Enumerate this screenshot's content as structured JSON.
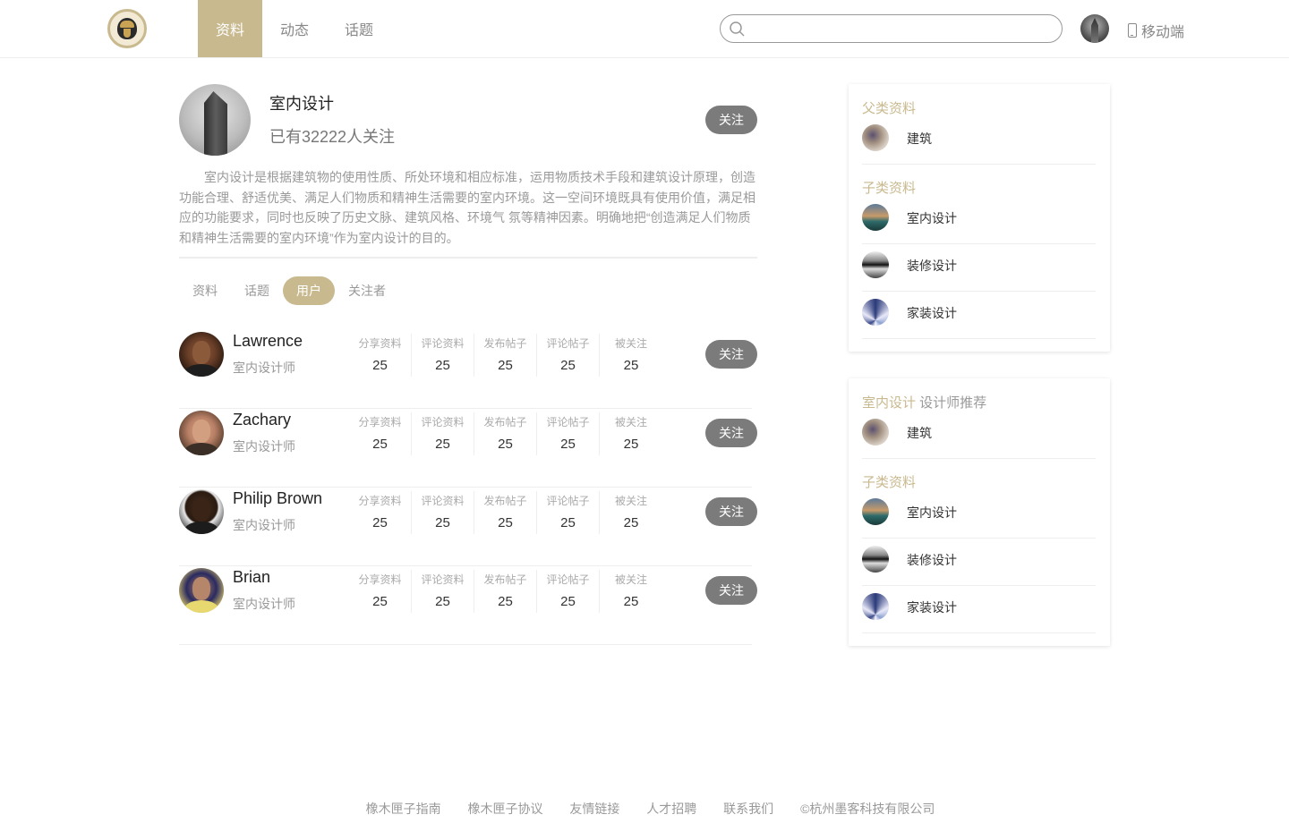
{
  "nav": {
    "items": [
      {
        "label": "资料",
        "active": true
      },
      {
        "label": "动态",
        "active": false
      },
      {
        "label": "话题",
        "active": false
      }
    ],
    "search_placeholder": "",
    "mobile_label": "移动端"
  },
  "profile": {
    "title": "室内设计",
    "followers": "已有32222人关注",
    "follow_label": "关注",
    "description": "室内设计是根据建筑物的使用性质、所处环境和相应标准，运用物质技术手段和建筑设计原理，创造功能合理、舒适优美、满足人们物质和精神生活需要的室内环境。这一空间环境既具有使用价值，满足相应的功能要求，同时也反映了历史文脉、建筑风格、环境气 氛等精神因素。明确地把“创造满足人们物质和精神生活需要的室内环境”作为室内设计的目的。"
  },
  "tabs": [
    {
      "label": "资料",
      "active": false
    },
    {
      "label": "话题",
      "active": false
    },
    {
      "label": "用户",
      "active": true
    },
    {
      "label": "关注者",
      "active": false
    }
  ],
  "stat_labels": [
    "分享资料",
    "评论资料",
    "发布帖子",
    "评论帖子",
    "被关注"
  ],
  "users": [
    {
      "name": "Lawrence",
      "title": "室内设计师",
      "stats": [
        "25",
        "25",
        "25",
        "25",
        "25"
      ],
      "follow_label": "关注"
    },
    {
      "name": "Zachary",
      "title": "室内设计师",
      "stats": [
        "25",
        "25",
        "25",
        "25",
        "25"
      ],
      "follow_label": "关注"
    },
    {
      "name": "Philip Brown",
      "title": "室内设计师",
      "stats": [
        "25",
        "25",
        "25",
        "25",
        "25"
      ],
      "follow_label": "关注"
    },
    {
      "name": "Brian",
      "title": "室内设计师",
      "stats": [
        "25",
        "25",
        "25",
        "25",
        "25"
      ],
      "follow_label": "关注"
    }
  ],
  "sidebar": {
    "card1": {
      "parent_heading": "父类资料",
      "parent_items": [
        {
          "label": "建筑"
        }
      ],
      "child_heading": "子类资料",
      "child_items": [
        {
          "label": "室内设计"
        },
        {
          "label": "装修设计"
        },
        {
          "label": "家装设计"
        }
      ]
    },
    "card2": {
      "heading_main": "室内设计",
      "heading_sub": " 设计师推荐",
      "top_items": [
        {
          "label": "建筑"
        }
      ],
      "child_heading": "子类资料",
      "child_items": [
        {
          "label": "室内设计"
        },
        {
          "label": "装修设计"
        },
        {
          "label": "家装设计"
        }
      ]
    }
  },
  "footer": {
    "links": [
      "橡木匣子指南",
      "橡木匣子协议",
      "友情链接",
      "人才招聘",
      "联系我们"
    ],
    "copyright": "©杭州墨客科技有限公司"
  },
  "colors": {
    "accent": "#c9b98f",
    "button": "#7b7b7b",
    "muted": "#999999"
  }
}
